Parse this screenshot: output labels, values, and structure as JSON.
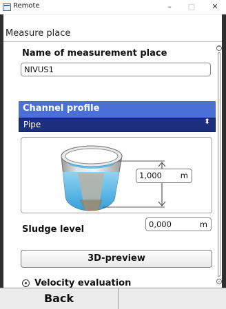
{
  "window": {
    "title": "Remote",
    "minimize": "–",
    "maximize": "□",
    "close": "✕"
  },
  "header": {
    "title": "Measure place"
  },
  "name_field": {
    "label": "Name of measurement place",
    "value": "NIVUS1"
  },
  "channel": {
    "label": "Channel profile",
    "selected": "Pipe",
    "arrow": "⬍"
  },
  "diagram": {
    "value": "1,000",
    "unit": "m"
  },
  "sludge": {
    "label": "Sludge level",
    "value": "0,000",
    "unit": "m"
  },
  "preview_button": {
    "label": "3D-preview"
  },
  "velocity": {
    "label": "Velocity evaluation"
  },
  "footer": {
    "back_label": "Back"
  },
  "colors": {
    "accent": "#4a70d8",
    "select_bg": "#1b2f7d",
    "water": "#4fb4e6"
  }
}
